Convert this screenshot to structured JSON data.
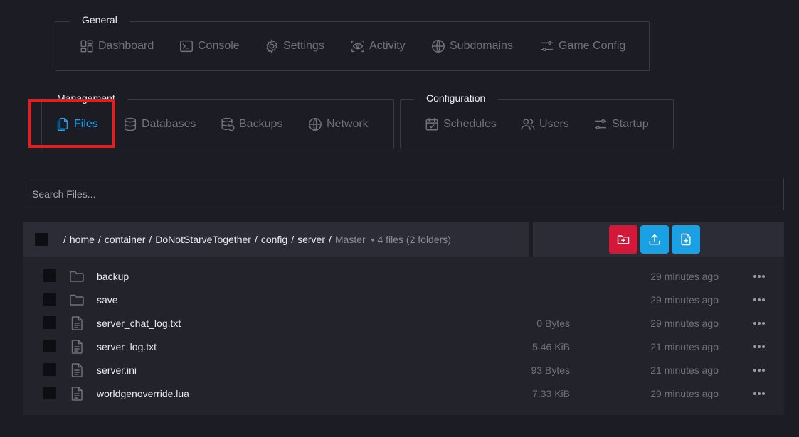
{
  "general": {
    "title": "General",
    "items": [
      {
        "label": "Dashboard"
      },
      {
        "label": "Console"
      },
      {
        "label": "Settings"
      },
      {
        "label": "Activity"
      },
      {
        "label": "Subdomains"
      },
      {
        "label": "Game Config"
      }
    ]
  },
  "management": {
    "title": "Management",
    "items": [
      {
        "label": "Files",
        "active": true
      },
      {
        "label": "Databases"
      },
      {
        "label": "Backups"
      },
      {
        "label": "Network"
      }
    ]
  },
  "configuration": {
    "title": "Configuration",
    "items": [
      {
        "label": "Schedules"
      },
      {
        "label": "Users"
      },
      {
        "label": "Startup"
      }
    ]
  },
  "search": {
    "placeholder": "Search Files..."
  },
  "path": {
    "slash": "/",
    "segments": [
      "home",
      "container",
      "DoNotStarveTogether",
      "config",
      "server"
    ],
    "current": "Master",
    "count": "• 4 files (2 folders)"
  },
  "actions": {
    "new_folder_color": "#d3183a",
    "upload_color": "#1aa1e3",
    "new_file_color": "#1aa1e3"
  },
  "files": [
    {
      "name": "backup",
      "type": "folder",
      "size": "",
      "modified": "29 minutes ago"
    },
    {
      "name": "save",
      "type": "folder",
      "size": "",
      "modified": "29 minutes ago"
    },
    {
      "name": "server_chat_log.txt",
      "type": "file",
      "size": "0 Bytes",
      "modified": "29 minutes ago"
    },
    {
      "name": "server_log.txt",
      "type": "file",
      "size": "5.46 KiB",
      "modified": "21 minutes ago"
    },
    {
      "name": "server.ini",
      "type": "file",
      "size": "93 Bytes",
      "modified": "21 minutes ago"
    },
    {
      "name": "worldgenoverride.lua",
      "type": "file",
      "size": "7.33 KiB",
      "modified": "29 minutes ago"
    }
  ]
}
